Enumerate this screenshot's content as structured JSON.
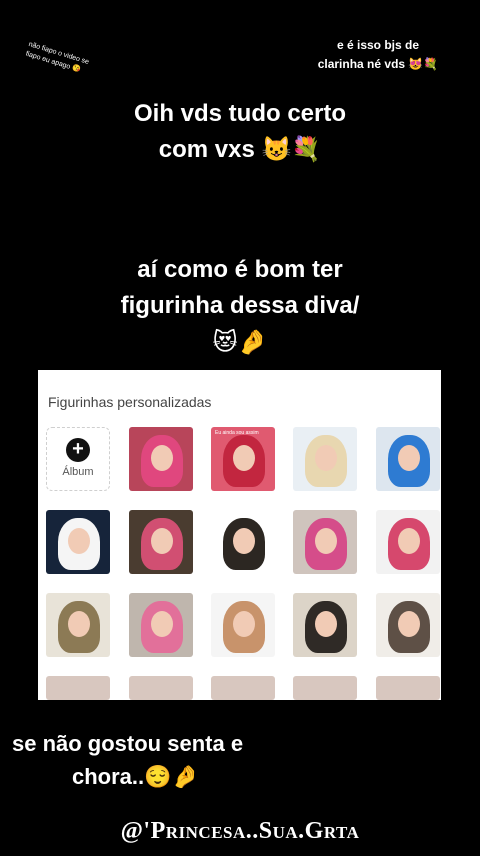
{
  "notes": {
    "tiny": "não fiapo o video se fiapo eu apago 😘",
    "corner_line1": "e é isso bjs de",
    "corner_line2": "clarinha né vds 😻💐"
  },
  "headline1": {
    "line1": "Oih vds tudo certo",
    "line2": "com vxs 😺💐"
  },
  "headline2": {
    "line1": "aí como é bom ter",
    "line2": "figurinha dessa diva/",
    "line3": "😻🤌"
  },
  "panel": {
    "title": "Figurinhas personalizadas",
    "album_icon": "plus-icon",
    "album_label": "Álbum",
    "sticker_caption": "Eu ainda sou assim"
  },
  "stickers": [
    {
      "bg": "#b8455a",
      "hair": "#e0477e"
    },
    {
      "bg": "#e05a70",
      "hair": "#c2263f"
    },
    {
      "bg": "#e9eff4",
      "hair": "#e8d7b0"
    },
    {
      "bg": "#dde6ef",
      "hair": "#2e7bd2"
    },
    {
      "bg": "#16243a",
      "hair": "#f5f5f5"
    },
    {
      "bg": "#4a3c30",
      "hair": "#d14f72"
    },
    {
      "bg": "#ffffff",
      "hair": "#2c2722"
    },
    {
      "bg": "#cfc4bd",
      "hair": "#d54d8a"
    },
    {
      "bg": "#f2f2f2",
      "hair": "#d6486d"
    },
    {
      "bg": "#e8e3d8",
      "hair": "#8c7a55"
    },
    {
      "bg": "#bfb6ad",
      "hair": "#e2709a"
    },
    {
      "bg": "#f5f5f5",
      "hair": "#c8936b"
    },
    {
      "bg": "#dcd4c8",
      "hair": "#2f2a26"
    },
    {
      "bg": "#f0ede8",
      "hair": "#5e5046"
    }
  ],
  "bottom": {
    "line1": "se não gostou senta e",
    "line2": "chora..😌🤌"
  },
  "signature": "@'Princesa..Sua.Grta"
}
